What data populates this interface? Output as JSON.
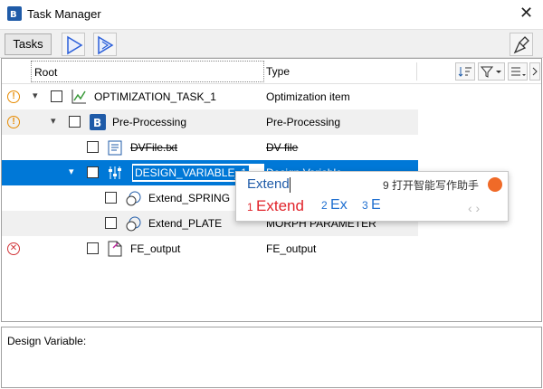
{
  "window": {
    "title": "Task Manager",
    "close_glyph": "✕"
  },
  "toolbar": {
    "tasks_label": "Tasks",
    "run_icon": "play-icon",
    "step_icon": "step-play-icon",
    "clean_icon": "broom-icon"
  },
  "tree": {
    "columns": {
      "root": "Root",
      "type": "Type"
    },
    "header_buttons": [
      "sort-icon",
      "filter-icon",
      "column-options-icon"
    ],
    "rows": [
      {
        "status": "warning",
        "indent": 0,
        "name": "OPTIMIZATION_TASK_1",
        "type": "Optimization item",
        "icon": "optimization-chart-icon"
      },
      {
        "status": "warning",
        "indent": 1,
        "name": "Pre-Processing",
        "type": "Pre-Processing",
        "icon": "pre-processing-icon"
      },
      {
        "status": "",
        "indent": 2,
        "name": "DVFile.txt",
        "type": "DV file",
        "icon": "notepad-icon",
        "strikethrough": true
      },
      {
        "status": "",
        "indent": 2,
        "name": "DESIGN_VARIABLE_1",
        "type": "Design Variable",
        "icon": "design-variable-icon",
        "selected": true,
        "editing": true
      },
      {
        "status": "",
        "indent": 3,
        "name": "Extend_SPRING",
        "type": "",
        "icon": "morph-parameter-icon"
      },
      {
        "status": "",
        "indent": 3,
        "name": "Extend_PLATE",
        "type": "MORPH PARAMETER",
        "icon": "morph-parameter-icon"
      },
      {
        "status": "error",
        "indent": 1,
        "name": "FE_output",
        "type": "FE_output",
        "icon": "output-file-icon"
      }
    ]
  },
  "ime": {
    "composition": "Extend",
    "assistant": "9 打开智能写作助手",
    "candidates": [
      {
        "num": "1",
        "text": "Extend"
      },
      {
        "num": "2",
        "text": "Ex"
      },
      {
        "num": "3",
        "text": "E"
      }
    ],
    "nav": "‹ ›"
  },
  "description": {
    "label": "Design Variable:"
  },
  "colors": {
    "accent": "#0078d7",
    "warning": "#e68a00",
    "error": "#d13438",
    "ime_highlight": "#e1242b",
    "ime_blue": "#1f6fd0"
  }
}
